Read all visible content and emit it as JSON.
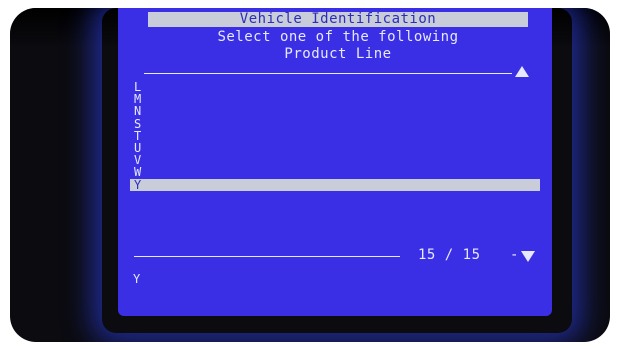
{
  "header": {
    "title": "Vehicle Identification",
    "prompt_line1": "Select one of the following",
    "prompt_line2": "Product Line"
  },
  "list": {
    "items": [
      "L",
      "M",
      "N",
      "S",
      "T",
      "U",
      "V",
      "W",
      "Y"
    ],
    "selected_index": 8
  },
  "footer": {
    "page_indicator": "15 / 15",
    "dash": "-",
    "selected_value": "Y"
  },
  "colors": {
    "screen_background": "#3a2fe4",
    "highlight_bar": "#c9ccd9",
    "highlight_text": "#2a2fb8",
    "text": "#e6e9ff",
    "bezel": "#0b0b10"
  },
  "icons": {
    "scroll_up": "triangle-up-icon",
    "scroll_down": "triangle-down-icon"
  }
}
